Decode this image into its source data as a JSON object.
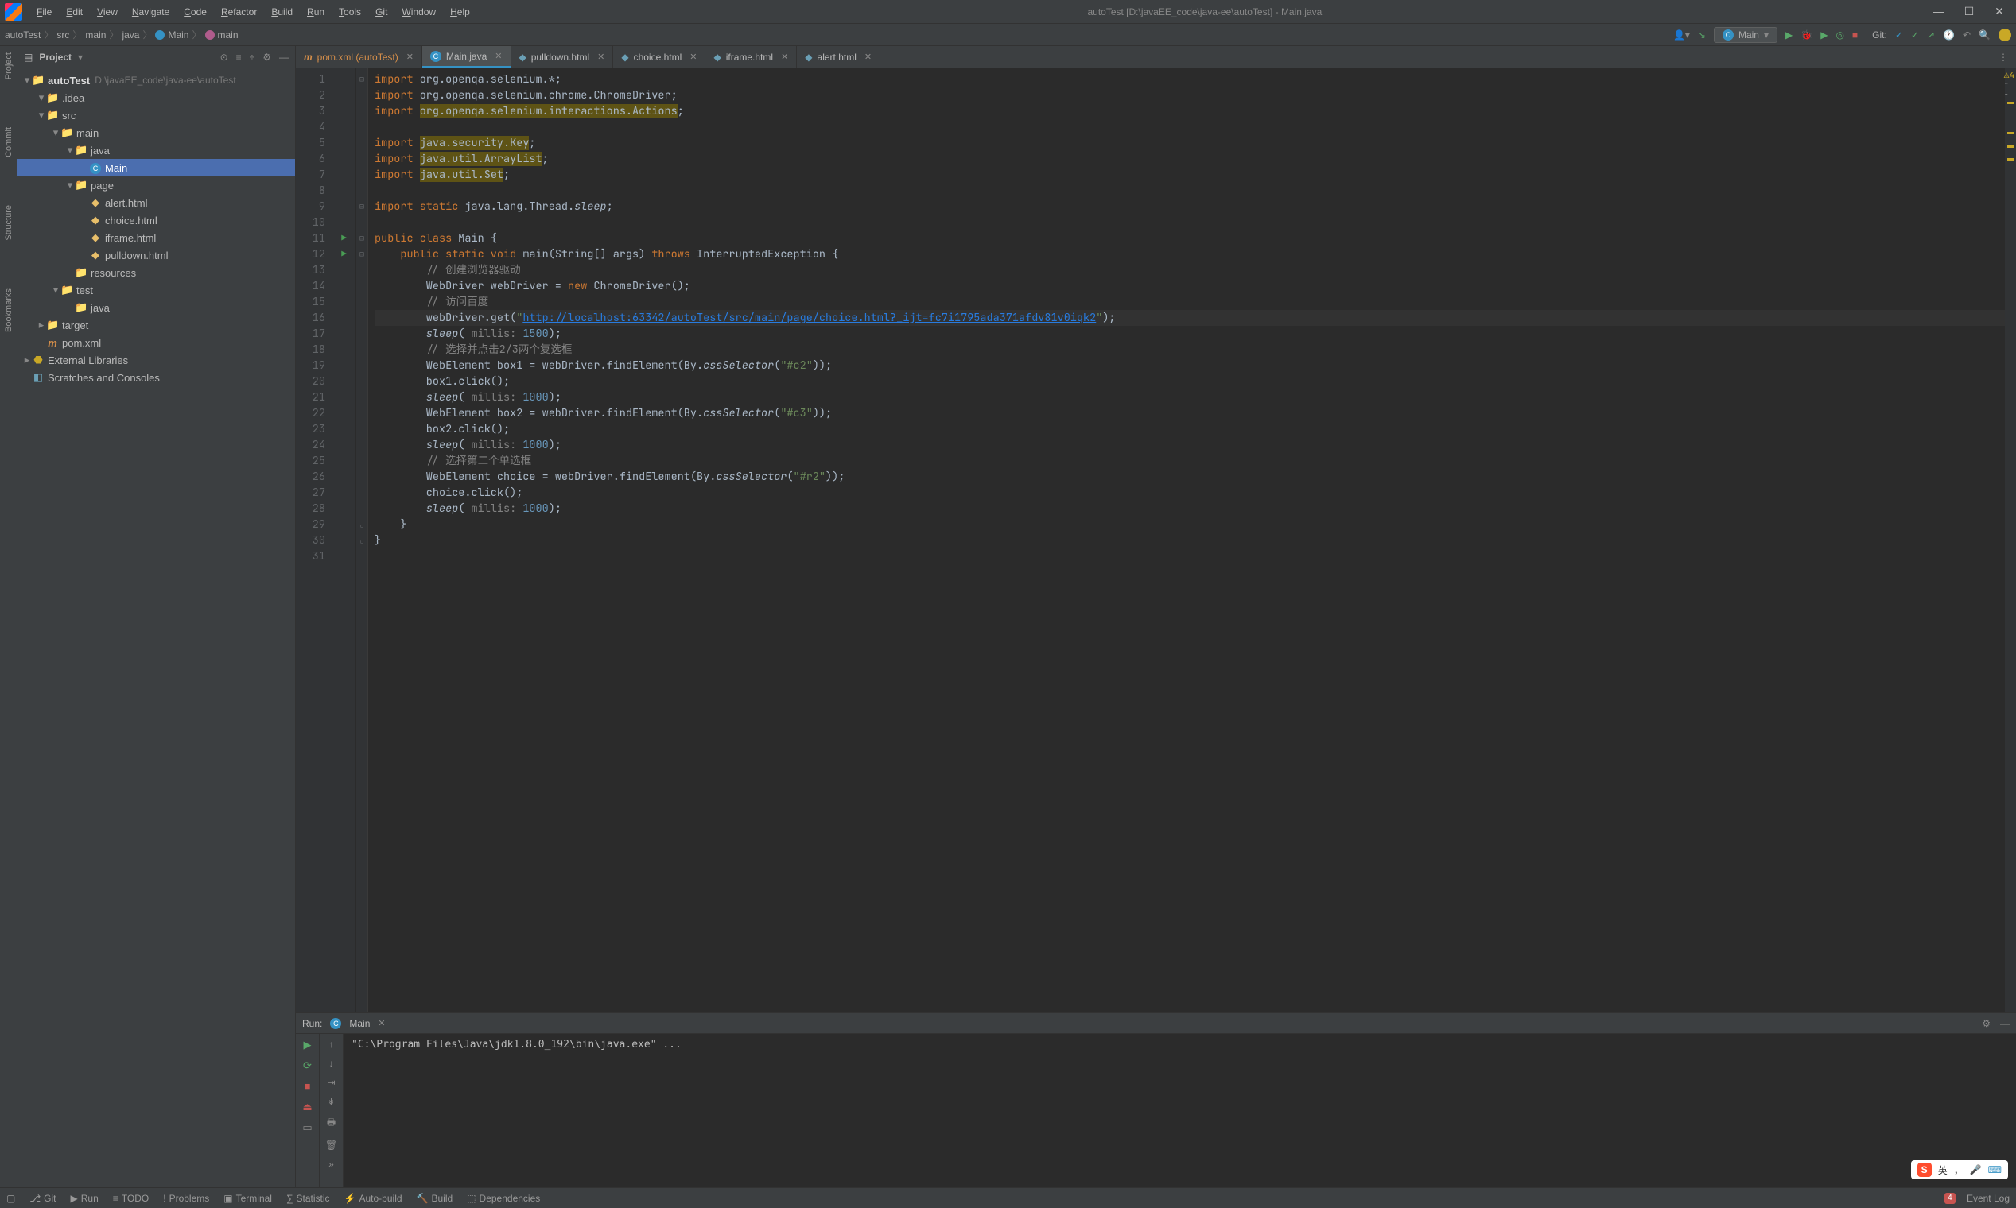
{
  "titlebar": {
    "menus": [
      "File",
      "Edit",
      "View",
      "Navigate",
      "Code",
      "Refactor",
      "Build",
      "Run",
      "Tools",
      "Git",
      "Window",
      "Help"
    ],
    "title": "autoTest [D:\\javaEE_code\\java-ee\\autoTest] - Main.java"
  },
  "breadcrumbs": [
    "autoTest",
    "src",
    "main",
    "java",
    "Main",
    "main"
  ],
  "run_config": "Main",
  "git_label": "Git:",
  "warn_count": "4",
  "project_panel": {
    "title": "Project",
    "root": {
      "name": "autoTest",
      "hint": "D:\\javaEE_code\\java-ee\\autoTest"
    },
    "items": [
      {
        "depth": 1,
        "arrow": "▾",
        "icon": "folder",
        "name": ".idea"
      },
      {
        "depth": 1,
        "arrow": "▾",
        "icon": "src",
        "name": "src"
      },
      {
        "depth": 2,
        "arrow": "▾",
        "icon": "folder",
        "name": "main"
      },
      {
        "depth": 3,
        "arrow": "▾",
        "icon": "src",
        "name": "java"
      },
      {
        "depth": 4,
        "arrow": " ",
        "icon": "class",
        "name": "Main",
        "sel": true
      },
      {
        "depth": 3,
        "arrow": "▾",
        "icon": "folder",
        "name": "page"
      },
      {
        "depth": 4,
        "arrow": " ",
        "icon": "html",
        "name": "alert.html"
      },
      {
        "depth": 4,
        "arrow": " ",
        "icon": "html",
        "name": "choice.html"
      },
      {
        "depth": 4,
        "arrow": " ",
        "icon": "html",
        "name": "iframe.html"
      },
      {
        "depth": 4,
        "arrow": " ",
        "icon": "html",
        "name": "pulldown.html"
      },
      {
        "depth": 3,
        "arrow": " ",
        "icon": "res",
        "name": "resources"
      },
      {
        "depth": 2,
        "arrow": "▾",
        "icon": "test",
        "name": "test"
      },
      {
        "depth": 3,
        "arrow": " ",
        "icon": "test",
        "name": "java"
      },
      {
        "depth": 1,
        "arrow": "▸",
        "icon": "target",
        "name": "target"
      },
      {
        "depth": 1,
        "arrow": " ",
        "icon": "pom",
        "name": "pom.xml"
      }
    ],
    "ext_lib": "External Libraries",
    "scratches": "Scratches and Consoles"
  },
  "tabs": [
    {
      "icon": "pom",
      "label": "pom.xml (autoTest)",
      "color": "#d68f4a"
    },
    {
      "icon": "class",
      "label": "Main.java",
      "active": true
    },
    {
      "icon": "html",
      "label": "pulldown.html"
    },
    {
      "icon": "html",
      "label": "choice.html"
    },
    {
      "icon": "html",
      "label": "iframe.html"
    },
    {
      "icon": "html",
      "label": "alert.html"
    }
  ],
  "code_lines": [
    {
      "n": 1,
      "html": "<span class='kw'>import</span> org.openqa.selenium.*;"
    },
    {
      "n": 2,
      "html": "<span class='kw'>import</span> org.openqa.selenium.chrome.ChromeDriver;"
    },
    {
      "n": 3,
      "html": "<span class='kw'>import</span> <span class='warn-y'>org.openqa.selenium.interactions.Actions</span>;"
    },
    {
      "n": 4,
      "html": ""
    },
    {
      "n": 5,
      "html": "<span class='kw'>import</span> <span class='warn-y'>java.security.Key</span>;"
    },
    {
      "n": 6,
      "html": "<span class='kw'>import</span> <span class='warn-y'>java.util.ArrayList</span>;"
    },
    {
      "n": 7,
      "html": "<span class='kw'>import</span> <span class='warn-y'>java.util.Set</span>;"
    },
    {
      "n": 8,
      "html": ""
    },
    {
      "n": 9,
      "html": "<span class='kw'>import static</span> java.lang.Thread.<span class='fn'>sleep</span>;"
    },
    {
      "n": 10,
      "html": ""
    },
    {
      "n": 11,
      "html": "<span class='kw'>public class</span> Main {",
      "run": "▶"
    },
    {
      "n": 12,
      "html": "    <span class='kw'>public static void</span> main(String[] args) <span class='kw'>throws</span> InterruptedException {",
      "run": "▶"
    },
    {
      "n": 13,
      "html": "        <span class='cm'>// 创建浏览器驱动</span>"
    },
    {
      "n": 14,
      "html": "        WebDriver webDriver = <span class='kw'>new</span> ChromeDriver();"
    },
    {
      "n": 15,
      "html": "        <span class='cm'>// 访问百度</span>"
    },
    {
      "n": 16,
      "html": "        webDriver.get(<span class='str'>\"</span><span class='url'>http://localhost:63342/autoTest/src/main/page/choice.html?_ijt=fc7i1795ada371afdv81v0iqk2</span><span class='str'>\"</span>);",
      "cur": true
    },
    {
      "n": 17,
      "html": "        <span class='fn'>sleep</span>( <span class='cm'>millis:</span> <span class='num'>1500</span>);"
    },
    {
      "n": 18,
      "html": "        <span class='cm'>// 选择并点击2/3两个复选框</span>"
    },
    {
      "n": 19,
      "html": "        WebElement box1 = webDriver.findElement(By.<span class='fn'>cssSelector</span>(<span class='str'>\"#c2\"</span>));"
    },
    {
      "n": 20,
      "html": "        box1.click();"
    },
    {
      "n": 21,
      "html": "        <span class='fn'>sleep</span>( <span class='cm'>millis:</span> <span class='num'>1000</span>);"
    },
    {
      "n": 22,
      "html": "        WebElement box2 = webDriver.findElement(By.<span class='fn'>cssSelector</span>(<span class='str'>\"#c3\"</span>));"
    },
    {
      "n": 23,
      "html": "        box2.click();"
    },
    {
      "n": 24,
      "html": "        <span class='fn'>sleep</span>( <span class='cm'>millis:</span> <span class='num'>1000</span>);"
    },
    {
      "n": 25,
      "html": "        <span class='cm'>// 选择第二个单选框</span>"
    },
    {
      "n": 26,
      "html": "        WebElement choice = webDriver.findElement(By.<span class='fn'>cssSelector</span>(<span class='str'>\"#r2\"</span>));"
    },
    {
      "n": 27,
      "html": "        choice.click();"
    },
    {
      "n": 28,
      "html": "        <span class='fn'>sleep</span>( <span class='cm'>millis:</span> <span class='num'>1000</span>);"
    },
    {
      "n": 29,
      "html": "    }"
    },
    {
      "n": 30,
      "html": "}"
    },
    {
      "n": 31,
      "html": ""
    }
  ],
  "run_panel": {
    "title_prefix": "Run:",
    "title": "Main",
    "output": "\"C:\\Program Files\\Java\\jdk1.8.0_192\\bin\\java.exe\" ..."
  },
  "statusbar": {
    "items": [
      "Git",
      "Run",
      "TODO",
      "Problems",
      "Terminal",
      "Statistic",
      "Auto-build",
      "Build",
      "Dependencies"
    ],
    "event_log": "Event Log",
    "event_badge": "4"
  },
  "left_gutter": [
    "Project",
    "Commit",
    "Structure",
    "Bookmarks"
  ],
  "ime": "英"
}
